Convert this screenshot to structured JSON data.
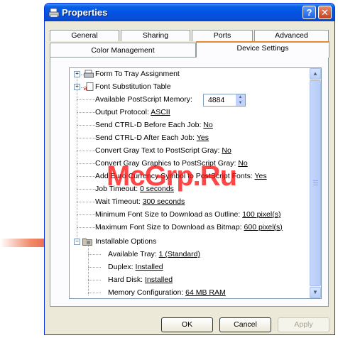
{
  "window": {
    "title": "Properties",
    "help_label": "?",
    "close_label": "✕"
  },
  "tabs": {
    "row1": [
      "General",
      "Sharing",
      "Ports",
      "Advanced"
    ],
    "row2": [
      "Color Management",
      "Device Settings"
    ],
    "active": "Device Settings"
  },
  "tree": {
    "items": [
      {
        "label": "Form To Tray Assignment",
        "value": "",
        "icon": "tray-icon",
        "expander": "+"
      },
      {
        "label": "Font Substitution Table",
        "value": "",
        "icon": "font-icon",
        "expander": "+"
      },
      {
        "label": "Available PostScript Memory:",
        "value": "4884",
        "control": "spin"
      },
      {
        "label": "Output Protocol:",
        "value": "ASCII"
      },
      {
        "label": "Send CTRL-D Before Each Job:",
        "value": "No"
      },
      {
        "label": "Send CTRL-D After Each Job:",
        "value": "Yes"
      },
      {
        "label": "Convert Gray Text to PostScript Gray:",
        "value": "No"
      },
      {
        "label": "Convert Gray Graphics to PostScript Gray:",
        "value": "No"
      },
      {
        "label": "Add Euro Currency Symbol to PostScript Fonts:",
        "value": "Yes"
      },
      {
        "label": "Job Timeout:",
        "value": "0 seconds"
      },
      {
        "label": "Wait Timeout:",
        "value": "300 seconds"
      },
      {
        "label": "Minimum Font Size to Download as Outline:",
        "value": "100 pixel(s)"
      },
      {
        "label": "Maximum Font Size to Download as Bitmap:",
        "value": "600 pixel(s)"
      },
      {
        "label": "Installable Options",
        "value": "",
        "icon": "options-folder-icon",
        "expander": "−"
      },
      {
        "label": "Available Tray:",
        "value": "1 (Standard)",
        "level": 2
      },
      {
        "label": "Duplex:",
        "value": "Installed",
        "level": 2
      },
      {
        "label": "Hard Disk:",
        "value": "Installed",
        "level": 2
      },
      {
        "label": "Memory Configuration:",
        "value": "64 MB RAM",
        "level": 2
      }
    ]
  },
  "buttons": {
    "ok": "OK",
    "cancel": "Cancel",
    "apply": "Apply"
  },
  "watermark": "McGrp.Ru",
  "colors": {
    "titlebar": "#0054e3",
    "arrow": "#e8402a",
    "watermark": "#ff0000"
  }
}
